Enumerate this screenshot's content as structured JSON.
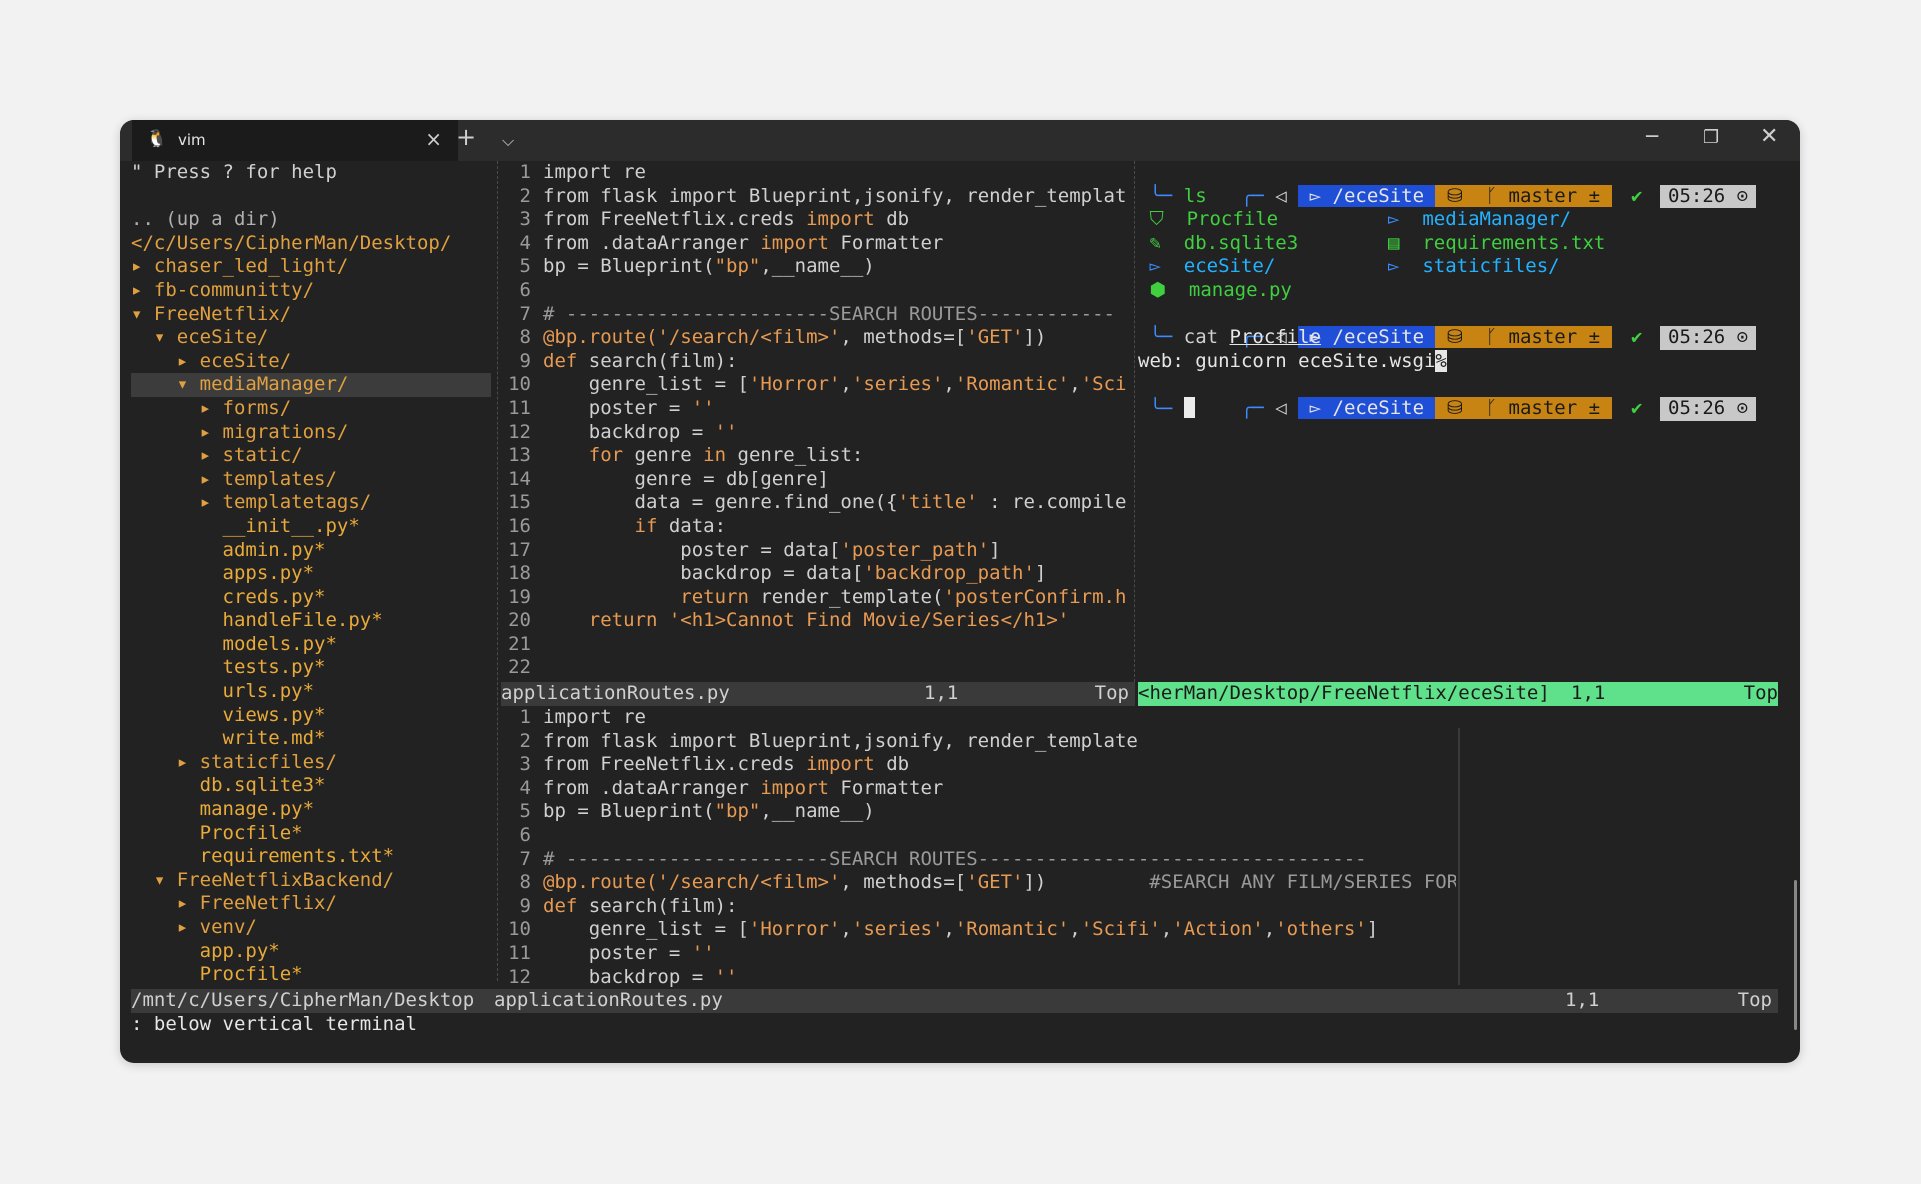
{
  "window": {
    "tab_title": "vim",
    "tab_icon": "linux-tux-icon"
  },
  "nerdtree": {
    "help": "\" Press ? for help",
    "up_dir": ".. (up a dir)",
    "root": "</c/Users/CipherMan/Desktop/",
    "items": [
      {
        "marker": "▸",
        "name": "chaser_led_light/",
        "depth": 0,
        "type": "dir"
      },
      {
        "marker": "▸",
        "name": "fb-communitty/",
        "depth": 0,
        "type": "dir"
      },
      {
        "marker": "▾",
        "name": "FreeNetflix/",
        "depth": 0,
        "type": "dir"
      },
      {
        "marker": "▾",
        "name": "eceSite/",
        "depth": 1,
        "type": "dir"
      },
      {
        "marker": "▸",
        "name": "eceSite/",
        "depth": 2,
        "type": "dir"
      },
      {
        "marker": "▾",
        "name": "mediaManager/",
        "depth": 2,
        "type": "dir",
        "selected": true
      },
      {
        "marker": "▸",
        "name": "forms/",
        "depth": 3,
        "type": "dir"
      },
      {
        "marker": "▸",
        "name": "migrations/",
        "depth": 3,
        "type": "dir"
      },
      {
        "marker": "▸",
        "name": "static/",
        "depth": 3,
        "type": "dir"
      },
      {
        "marker": "▸",
        "name": "templates/",
        "depth": 3,
        "type": "dir"
      },
      {
        "marker": "▸",
        "name": "templatetags/",
        "depth": 3,
        "type": "dir"
      },
      {
        "marker": "",
        "name": "__init__.py*",
        "depth": 3,
        "type": "file"
      },
      {
        "marker": "",
        "name": "admin.py*",
        "depth": 3,
        "type": "file"
      },
      {
        "marker": "",
        "name": "apps.py*",
        "depth": 3,
        "type": "file"
      },
      {
        "marker": "",
        "name": "creds.py*",
        "depth": 3,
        "type": "file"
      },
      {
        "marker": "",
        "name": "handleFile.py*",
        "depth": 3,
        "type": "file"
      },
      {
        "marker": "",
        "name": "models.py*",
        "depth": 3,
        "type": "file"
      },
      {
        "marker": "",
        "name": "tests.py*",
        "depth": 3,
        "type": "file"
      },
      {
        "marker": "",
        "name": "urls.py*",
        "depth": 3,
        "type": "file"
      },
      {
        "marker": "",
        "name": "views.py*",
        "depth": 3,
        "type": "file"
      },
      {
        "marker": "",
        "name": "write.md*",
        "depth": 3,
        "type": "file"
      },
      {
        "marker": "▸",
        "name": "staticfiles/",
        "depth": 2,
        "type": "dir"
      },
      {
        "marker": "",
        "name": "db.sqlite3*",
        "depth": 2,
        "type": "file"
      },
      {
        "marker": "",
        "name": "manage.py*",
        "depth": 2,
        "type": "file"
      },
      {
        "marker": "",
        "name": "Procfile*",
        "depth": 2,
        "type": "file"
      },
      {
        "marker": "",
        "name": "requirements.txt*",
        "depth": 2,
        "type": "file"
      },
      {
        "marker": "▾",
        "name": "FreeNetflixBackend/",
        "depth": 1,
        "type": "dir"
      },
      {
        "marker": "▸",
        "name": "FreeNetflix/",
        "depth": 2,
        "type": "dir"
      },
      {
        "marker": "▸",
        "name": "venv/",
        "depth": 2,
        "type": "dir"
      },
      {
        "marker": "",
        "name": "app.py*",
        "depth": 2,
        "type": "file"
      },
      {
        "marker": "",
        "name": "Procfile*",
        "depth": 2,
        "type": "file"
      }
    ],
    "status": "/mnt/c/Users/CipherMan/Desktop"
  },
  "editor_top": {
    "lines": [
      [
        {
          "t": "import",
          "c": "d"
        },
        {
          "t": " re",
          "c": "d"
        }
      ],
      [
        {
          "t": "from flask ",
          "c": "d"
        },
        {
          "t": "import",
          "c": "d"
        },
        {
          "t": " Blueprint,jsonify, render_templat",
          "c": "d"
        }
      ],
      [
        {
          "t": "from FreeNetflix.creds ",
          "c": "d"
        },
        {
          "t": "import",
          "c": "kw"
        },
        {
          "t": " db",
          "c": "d"
        }
      ],
      [
        {
          "t": "from .dataArranger ",
          "c": "d"
        },
        {
          "t": "import",
          "c": "kw"
        },
        {
          "t": " Formatter",
          "c": "d"
        }
      ],
      [
        {
          "t": "bp = Blueprint(",
          "c": "d"
        },
        {
          "t": "\"bp\"",
          "c": "str"
        },
        {
          "t": ",__name__)",
          "c": "d"
        }
      ],
      [
        {
          "t": "",
          "c": "d"
        }
      ],
      [
        {
          "t": "# -----------------------SEARCH ROUTES------------",
          "c": "cm"
        }
      ],
      [
        {
          "t": "@bp.route(",
          "c": "dec"
        },
        {
          "t": "'/search/<film>'",
          "c": "str"
        },
        {
          "t": ", methods=[",
          "c": "d"
        },
        {
          "t": "'GET'",
          "c": "str"
        },
        {
          "t": "])",
          "c": "d"
        }
      ],
      [
        {
          "t": "def",
          "c": "kw"
        },
        {
          "t": " search(film):",
          "c": "d"
        }
      ],
      [
        {
          "t": "    genre_list = [",
          "c": "d"
        },
        {
          "t": "'Horror'",
          "c": "str"
        },
        {
          "t": ",",
          "c": "d"
        },
        {
          "t": "'series'",
          "c": "str"
        },
        {
          "t": ",",
          "c": "d"
        },
        {
          "t": "'Romantic'",
          "c": "str"
        },
        {
          "t": ",",
          "c": "d"
        },
        {
          "t": "'Sci",
          "c": "str"
        }
      ],
      [
        {
          "t": "    poster = ",
          "c": "d"
        },
        {
          "t": "''",
          "c": "str"
        }
      ],
      [
        {
          "t": "    backdrop = ",
          "c": "d"
        },
        {
          "t": "''",
          "c": "str"
        }
      ],
      [
        {
          "t": "    ",
          "c": "d"
        },
        {
          "t": "for",
          "c": "kw"
        },
        {
          "t": " genre ",
          "c": "d"
        },
        {
          "t": "in",
          "c": "kw"
        },
        {
          "t": " genre_list:",
          "c": "d"
        }
      ],
      [
        {
          "t": "        genre = db[genre]",
          "c": "d"
        }
      ],
      [
        {
          "t": "        data = genre.find_one({",
          "c": "d"
        },
        {
          "t": "'title'",
          "c": "str"
        },
        {
          "t": " : re.compile",
          "c": "d"
        }
      ],
      [
        {
          "t": "        ",
          "c": "d"
        },
        {
          "t": "if",
          "c": "kw"
        },
        {
          "t": " data:",
          "c": "d"
        }
      ],
      [
        {
          "t": "            poster = data[",
          "c": "d"
        },
        {
          "t": "'poster_path'",
          "c": "str"
        },
        {
          "t": "]",
          "c": "d"
        }
      ],
      [
        {
          "t": "            backdrop = data[",
          "c": "d"
        },
        {
          "t": "'backdrop_path'",
          "c": "str"
        },
        {
          "t": "]",
          "c": "d"
        }
      ],
      [
        {
          "t": "            ",
          "c": "d"
        },
        {
          "t": "return",
          "c": "kw"
        },
        {
          "t": " render_template(",
          "c": "d"
        },
        {
          "t": "'posterConfirm.h",
          "c": "str"
        }
      ],
      [
        {
          "t": "    ",
          "c": "d"
        },
        {
          "t": "return",
          "c": "kw"
        },
        {
          "t": " ",
          "c": "d"
        },
        {
          "t": "'<h1>Cannot Find Movie/Series</h1>'",
          "c": "str"
        }
      ],
      [
        {
          "t": "",
          "c": "d"
        }
      ],
      [
        {
          "t": "",
          "c": "d"
        }
      ]
    ],
    "status_file": "applicationRoutes.py",
    "status_pos": "1,1",
    "status_scroll": "Top"
  },
  "editor_bottom": {
    "lines": [
      [
        {
          "t": "import re",
          "c": "d"
        }
      ],
      [
        {
          "t": "from flask import Blueprint,jsonify, render_template",
          "c": "d"
        }
      ],
      [
        {
          "t": "from FreeNetflix.creds ",
          "c": "d"
        },
        {
          "t": "import",
          "c": "kw"
        },
        {
          "t": " db",
          "c": "d"
        }
      ],
      [
        {
          "t": "from .dataArranger ",
          "c": "d"
        },
        {
          "t": "import",
          "c": "kw"
        },
        {
          "t": " Formatter",
          "c": "d"
        }
      ],
      [
        {
          "t": "bp = Blueprint(",
          "c": "d"
        },
        {
          "t": "\"bp\"",
          "c": "str"
        },
        {
          "t": ",__name__)",
          "c": "d"
        }
      ],
      [
        {
          "t": "",
          "c": "d"
        }
      ],
      [
        {
          "t": "# -----------------------SEARCH ROUTES----------------------------------",
          "c": "cm"
        }
      ],
      [
        {
          "t": "@bp.route(",
          "c": "dec"
        },
        {
          "t": "'/search/<film>'",
          "c": "str"
        },
        {
          "t": ", methods=[",
          "c": "d"
        },
        {
          "t": "'GET'",
          "c": "str"
        },
        {
          "t": "])",
          "c": "d"
        },
        {
          "t": "         #SEARCH ANY FILM/SERIES FOR POSTERS",
          "c": "cm"
        }
      ],
      [
        {
          "t": "def",
          "c": "kw"
        },
        {
          "t": " search(film):",
          "c": "d"
        }
      ],
      [
        {
          "t": "    genre_list = [",
          "c": "d"
        },
        {
          "t": "'Horror'",
          "c": "str"
        },
        {
          "t": ",",
          "c": "d"
        },
        {
          "t": "'series'",
          "c": "str"
        },
        {
          "t": ",",
          "c": "d"
        },
        {
          "t": "'Romantic'",
          "c": "str"
        },
        {
          "t": ",",
          "c": "d"
        },
        {
          "t": "'Scifi'",
          "c": "str"
        },
        {
          "t": ",",
          "c": "d"
        },
        {
          "t": "'Action'",
          "c": "str"
        },
        {
          "t": ",",
          "c": "d"
        },
        {
          "t": "'others'",
          "c": "str"
        },
        {
          "t": "]",
          "c": "d"
        }
      ],
      [
        {
          "t": "    poster = ",
          "c": "d"
        },
        {
          "t": "''",
          "c": "str"
        }
      ],
      [
        {
          "t": "    backdrop = ",
          "c": "d"
        },
        {
          "t": "''",
          "c": "str"
        }
      ]
    ],
    "status_file": "applicationRoutes.py",
    "status_pos": "1,1",
    "status_scroll": "Top"
  },
  "terminal": {
    "prompt_dir": "/eceSite",
    "prompt_branch": "master ±",
    "prompt_check": "✔",
    "prompt_time": "05:26",
    "cmd1": "ls",
    "ls_items": [
      {
        "name": "Procfile",
        "color": "green",
        "icon": "gem-icon"
      },
      {
        "name": "mediaManager/",
        "color": "cyan",
        "icon": "folder-icon"
      },
      {
        "name": "db.sqlite3",
        "color": "green",
        "icon": "pen-icon"
      },
      {
        "name": "requirements.txt",
        "color": "green",
        "icon": "file-icon"
      },
      {
        "name": "eceSite/",
        "color": "cyan",
        "icon": "folder-icon"
      },
      {
        "name": "staticfiles/",
        "color": "cyan",
        "icon": "folder-icon"
      },
      {
        "name": "manage.py",
        "color": "green",
        "icon": "python-icon"
      }
    ],
    "cmd2_prefix": "cat ",
    "cmd2_arg": "Procfile",
    "output": "web: gunicorn eceSite.wsgi",
    "output_tail": "%",
    "status_path": "<herMan/Desktop/FreeNetflix/eceSite]",
    "status_pos": "1,1",
    "status_scroll": "Top"
  },
  "cmdline": ": below vertical terminal"
}
